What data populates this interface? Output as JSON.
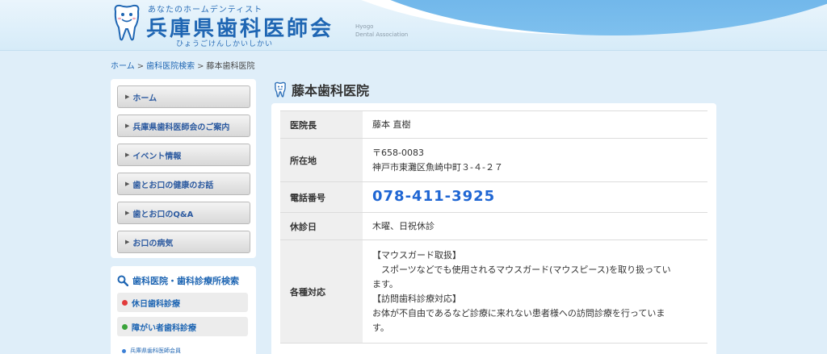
{
  "header": {
    "tagline": "あなたのホームデンティスト",
    "title": "兵庫県歯科医師会",
    "reading": "ひょうごけんしかいしかい",
    "english_line1": "Hyogo",
    "english_line2": "Dental Association"
  },
  "breadcrumb": {
    "home": "ホーム",
    "search": "歯科医院検索",
    "current": "藤本歯科医院",
    "separator": ">"
  },
  "sidebar": {
    "menu": [
      {
        "label": "ホーム"
      },
      {
        "label": "兵庫県歯科医師会のご案内"
      },
      {
        "label": "イベント情報"
      },
      {
        "label": "歯とお口の健康のお話"
      },
      {
        "label": "歯とお口のQ&A"
      },
      {
        "label": "お口の病気"
      }
    ],
    "search_title": "歯科医院・歯科診療所検索",
    "search_items": [
      {
        "label": "休日歯科診療",
        "dot_color": "#e23b3b"
      },
      {
        "label": "障がい者歯科診療",
        "dot_color": "#3aa33a"
      },
      {
        "label": "兵庫県歯科医師会員",
        "dot_color": "#3b7fd6"
      }
    ]
  },
  "clinic": {
    "name": "藤本歯科医院",
    "rows": {
      "director_label": "医院長",
      "director_value": "藤本 直樹",
      "address_label": "所在地",
      "address_postal": "〒658-0083",
      "address_line": "神戸市東灘区魚崎中町３-４-２７",
      "phone_label": "電話番号",
      "phone_value": "078-411-3925",
      "closed_label": "休診日",
      "closed_value": "木曜、日祝休診",
      "services_label": "各種対応",
      "services_line1": "【マウスガード取扱】",
      "services_line2": "　スポーツなどでも使用されるマウスガード(マウスピース)を取り扱ってい",
      "services_line3": "ます。",
      "services_line4": "【訪問歯科診療対応】",
      "services_line5": "お体が不自由であるなど診療に来れない患者様への訪問診療を行っていま",
      "services_line6": "す。"
    }
  },
  "colors": {
    "brand_blue": "#1f66b3",
    "page_bg": "#dfeef9",
    "phone_blue": "#1f66d3"
  }
}
